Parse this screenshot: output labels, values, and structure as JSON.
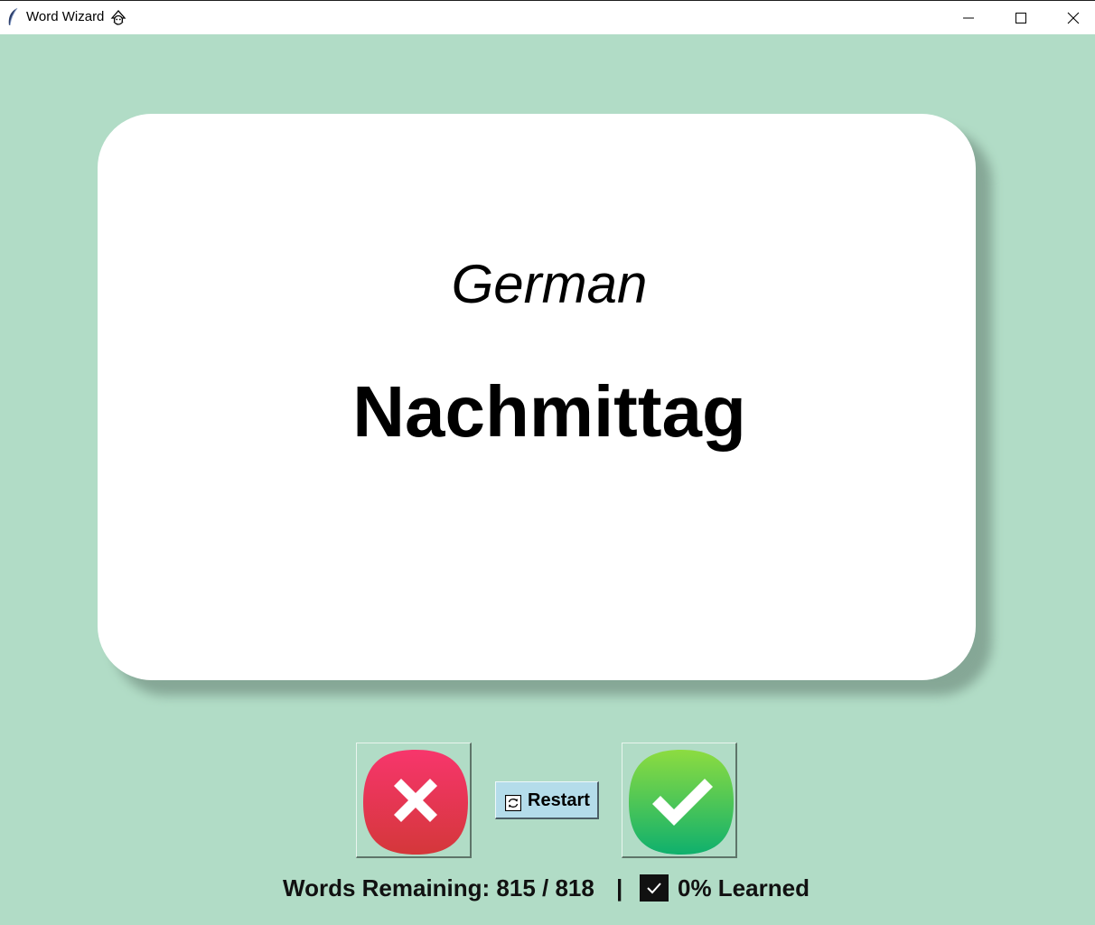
{
  "window": {
    "title": "Word Wizard",
    "title_emoji": "wizard-emoji-icon",
    "controls": [
      "minimize",
      "maximize",
      "close"
    ]
  },
  "card": {
    "language": "German",
    "word": "Nachmittag"
  },
  "actions": {
    "wrong_icon": "x-icon",
    "right_icon": "checkmark-icon",
    "restart_label": "Restart"
  },
  "status": {
    "words_remaining": "Words Remaining: 815 / 818",
    "separator": "|",
    "learned": "0% Learned"
  },
  "colors": {
    "background": "#b1dcc6",
    "card": "#ffffff",
    "wrong_button_top": "#f33f6a",
    "wrong_button_bottom": "#d7353a",
    "right_button_top": "#8dde3f",
    "right_button_bottom": "#12b36b",
    "restart_button": "#b4dcea"
  }
}
